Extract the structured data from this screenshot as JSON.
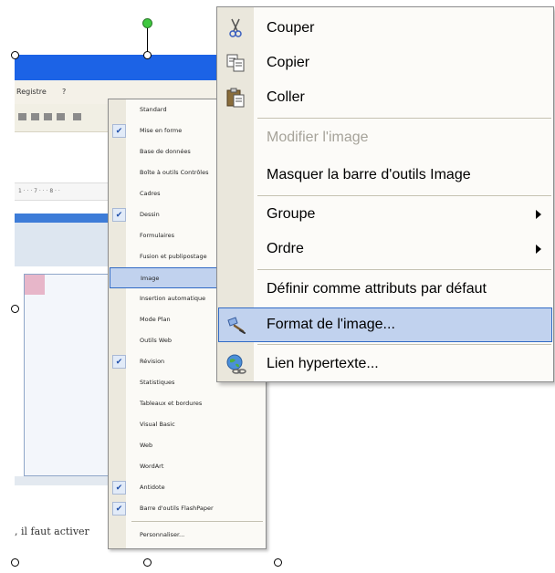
{
  "background_doc": {
    "menu_fragment": "Registre",
    "menu_fragment2": "?",
    "ruler_text": "1 · · · 7 · · · 8 · ·",
    "body_text": ", il faut activer"
  },
  "toolbars_menu": {
    "items": [
      {
        "label": "Standard",
        "checked": false
      },
      {
        "label": "Mise en forme",
        "checked": true
      },
      {
        "label": "Base de données",
        "checked": false
      },
      {
        "label": "Boîte à outils Contrôles",
        "checked": false
      },
      {
        "label": "Cadres",
        "checked": false
      },
      {
        "label": "Dessin",
        "checked": true
      },
      {
        "label": "Formulaires",
        "checked": false
      },
      {
        "label": "Fusion et publipostage",
        "checked": false
      },
      {
        "label": "Image",
        "checked": false,
        "highlighted": true
      },
      {
        "label": "Insertion automatique",
        "checked": false
      },
      {
        "label": "Mode Plan",
        "checked": false
      },
      {
        "label": "Outils Web",
        "checked": false
      },
      {
        "label": "Révision",
        "checked": true
      },
      {
        "label": "Statistiques",
        "checked": false
      },
      {
        "label": "Tableaux et bordures",
        "checked": false
      },
      {
        "label": "Visual Basic",
        "checked": false
      },
      {
        "label": "Web",
        "checked": false
      },
      {
        "label": "WordArt",
        "checked": false
      },
      {
        "label": "Antidote",
        "checked": true
      },
      {
        "label": "Barre d'outils FlashPaper",
        "checked": true
      }
    ],
    "customize_label": "Personnaliser..."
  },
  "context_menu": {
    "cut": "Couper",
    "copy": "Copier",
    "paste": "Coller",
    "edit_picture": "Modifier l'image",
    "hide_picture_toolbar": "Masquer la barre d'outils Image",
    "group": "Groupe",
    "order": "Ordre",
    "set_default": "Définir comme attributs par défaut",
    "format_picture": "Format de l'image...",
    "hyperlink": "Lien hypertexte..."
  },
  "colors": {
    "highlight_fill": "#c1d2ee",
    "highlight_border": "#316ac5",
    "title_blue": "#1c63e6",
    "disabled_text": "#a6a39a"
  }
}
